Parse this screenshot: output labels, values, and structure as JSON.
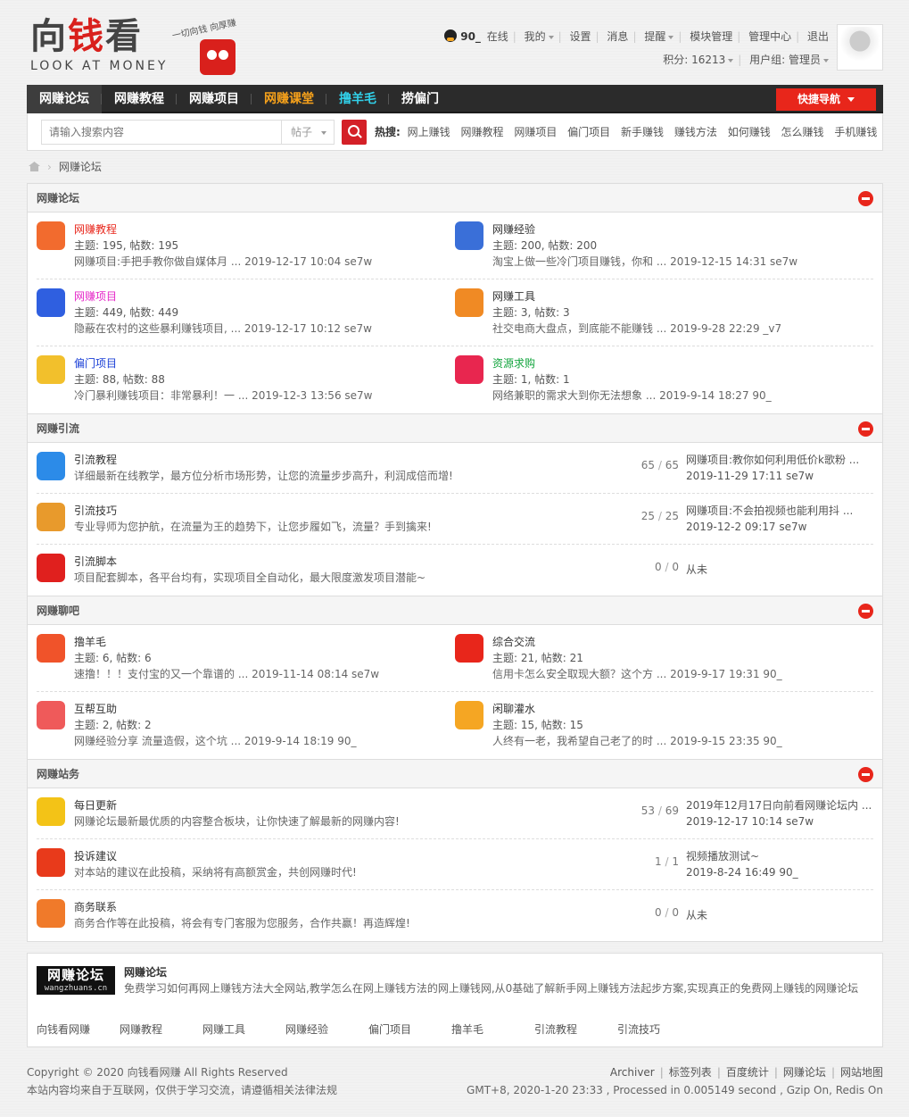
{
  "logo": {
    "cn_black1": "向",
    "cn_red": "钱",
    "cn_black2": "看",
    "en": "LOOK AT MONEY",
    "slogan": "一切向钱 向厚赚"
  },
  "user": {
    "name": "90_",
    "status": "在线",
    "links": [
      "我的",
      "设置",
      "消息",
      "提醒",
      "模块管理",
      "管理中心",
      "退出"
    ],
    "points_label": "积分: 16213",
    "group_label": "用户组: 管理员"
  },
  "nav": {
    "items": [
      {
        "label": "网赚论坛",
        "color": "#ffffff"
      },
      {
        "label": "网赚教程",
        "color": "#ffffff"
      },
      {
        "label": "网赚项目",
        "color": "#ffffff"
      },
      {
        "label": "网赚课堂",
        "color": "#f7a21b"
      },
      {
        "label": "撸羊毛",
        "color": "#31d0e9"
      },
      {
        "label": "捞偏门",
        "color": "#ffffff"
      }
    ],
    "quicknav": "快捷导航"
  },
  "search": {
    "placeholder": "请输入搜索内容",
    "type": "帖子",
    "hot_label": "热搜:",
    "hot_words": [
      "网上赚钱",
      "网赚教程",
      "网赚项目",
      "偏门项目",
      "新手赚钱",
      "赚钱方法",
      "如何赚钱",
      "怎么赚钱",
      "手机赚钱"
    ]
  },
  "breadcrumb": {
    "current": "网赚论坛"
  },
  "sections": {
    "s1": {
      "title": "网赚论坛",
      "forums": [
        {
          "name": "网赚教程",
          "color": "#e8261b",
          "meta": "主题: 195, 帖数: 195",
          "last": "网赚项目:手把手教你做自媒体月 ... 2019-12-17 10:04 se7w",
          "icon": "#f26b2e"
        },
        {
          "name": "网赚经验",
          "color": "#333333",
          "meta": "主题: 200, 帖数: 200",
          "last": "淘宝上做一些冷门项目赚钱，你和 ... 2019-12-15 14:31 se7w",
          "icon": "#3a6fd8"
        },
        {
          "name": "网赚项目",
          "color": "#e528c8",
          "meta": "主题: 449, 帖数: 449",
          "last": "隐蔽在农村的这些暴利赚钱项目, ... 2019-12-17 10:12 se7w",
          "icon": "#2f5fe0"
        },
        {
          "name": "网赚工具",
          "color": "#333333",
          "meta": "主题: 3, 帖数: 3",
          "last": "社交电商大盘点，到底能不能赚钱 ... 2019-9-28 22:29 _v7",
          "icon": "#f08a24"
        },
        {
          "name": "偏门项目",
          "color": "#1a3fd6",
          "meta": "主题: 88, 帖数: 88",
          "last": "冷门暴利赚钱项目：非常暴利！一 ... 2019-12-3 13:56 se7w",
          "icon": "#f2c02c"
        },
        {
          "name": "资源求购",
          "color": "#11a43c",
          "meta": "主题: 1, 帖数: 1",
          "last": "网络兼职的需求大到你无法想象 ... 2019-9-14 18:27 90_",
          "icon": "#e8264f"
        }
      ]
    },
    "s2": {
      "title": "网赚引流",
      "forums": [
        {
          "name": "引流教程",
          "desc": "详细最新在线教学，最方位分析市场形势，让您的流量步步高升，利润成倍而增!",
          "threads": "65",
          "posts": "65",
          "last1": "网赚项目:教你如何利用低价k歌粉 ...",
          "last2": "2019-11-29 17:11 se7w",
          "icon": "#2c8be8"
        },
        {
          "name": "引流技巧",
          "desc": "专业导师为您护航，在流量为王的趋势下，让您步履如飞，流量？手到擒来!",
          "threads": "25",
          "posts": "25",
          "last1": "网赚项目:不会拍视频也能利用抖 ...",
          "last2": "2019-12-2 09:17 se7w",
          "icon": "#e89a2c"
        },
        {
          "name": "引流脚本",
          "desc": "项目配套脚本，各平台均有，实现项目全自动化，最大限度激发项目潜能~",
          "threads": "0",
          "posts": "0",
          "last1": "从未",
          "last2": "",
          "icon": "#e0201e"
        }
      ]
    },
    "s3": {
      "title": "网赚聊吧",
      "forums": [
        {
          "name": "撸羊毛",
          "color": "#333333",
          "meta": "主题: 6, 帖数: 6",
          "last": "速撸！！！支付宝的又一个靠谱的 ... 2019-11-14 08:14 se7w",
          "icon": "#f0532a"
        },
        {
          "name": "综合交流",
          "color": "#333333",
          "meta": "主题: 21, 帖数: 21",
          "last": "信用卡怎么安全取现大额？这个方 ... 2019-9-17 19:31 90_",
          "icon": "#e8261b"
        },
        {
          "name": "互帮互助",
          "color": "#333333",
          "meta": "主题: 2, 帖数: 2",
          "last": "网赚经验分享 流量造假，这个坑 ... 2019-9-14 18:19 90_",
          "icon": "#ef5a5a"
        },
        {
          "name": "闲聊灌水",
          "color": "#333333",
          "meta": "主题: 15, 帖数: 15",
          "last": "人终有一老，我希望自己老了的时 ... 2019-9-15 23:35 90_",
          "icon": "#f5a623"
        }
      ]
    },
    "s4": {
      "title": "网赚站务",
      "forums": [
        {
          "name": "每日更新",
          "desc": "网赚论坛最新最优质的内容整合板块，让你快速了解最新的网赚内容!",
          "threads": "53",
          "posts": "69",
          "last1": "2019年12月17日向前看网赚论坛内 ...",
          "last2": "2019-12-17 10:14 se7w",
          "icon": "#f3c317"
        },
        {
          "name": "投诉建议",
          "desc": "对本站的建议在此投稿，采纳将有高额赏金，共创网赚时代!",
          "threads": "1",
          "posts": "1",
          "last1": "视频播放测试~",
          "last2": "2019-8-24 16:49 90_",
          "icon": "#e83a1b"
        },
        {
          "name": "商务联系",
          "desc": "商务合作等在此投稿，将会有专门客服为您服务，合作共赢！再造辉煌!",
          "threads": "0",
          "posts": "0",
          "last1": "从未",
          "last2": "",
          "icon": "#f07a2a"
        }
      ]
    }
  },
  "footer_info": {
    "logo_text": "网赚论坛",
    "logo_sub": "wangzhuans.cn",
    "title": "网赚论坛",
    "desc": "免费学习如何再网上赚钱方法大全网站,教学怎么在网上赚钱方法的网上赚钱网,从0基础了解新手网上赚钱方法起步方案,实现真正的免费网上赚钱的网赚论坛",
    "links": [
      "向钱看网赚",
      "网赚教程",
      "网赚工具",
      "网赚经验",
      "偏门项目",
      "撸羊毛",
      "引流教程",
      "引流技巧"
    ]
  },
  "copyright": {
    "line1": "Copyright © 2020 向钱看网赚 All Rights Reserved",
    "line2": "本站内容均来自于互联网，仅供于学习交流，请遵循相关法律法规",
    "links": [
      "Archiver",
      "标签列表",
      "百度统计",
      "网赚论坛",
      "网站地图"
    ],
    "stats": "GMT+8, 2020-1-20 23:33 , Processed in 0.005149 second , Gzip On, Redis On"
  }
}
